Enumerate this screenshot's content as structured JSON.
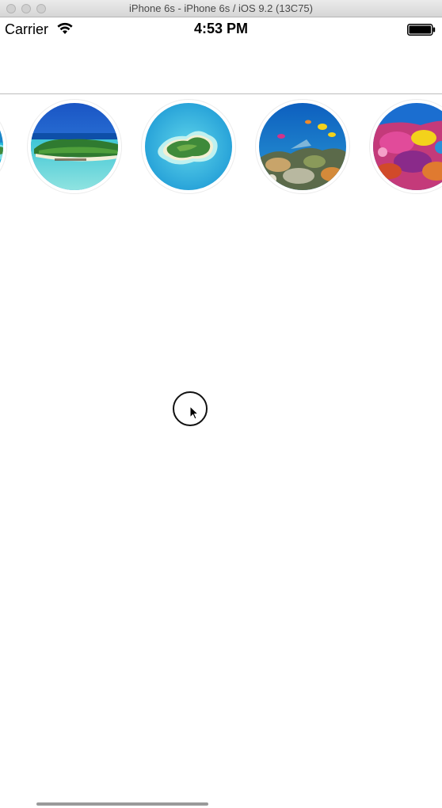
{
  "window": {
    "title": "iPhone 6s - iPhone 6s / iOS 9.2 (13C75)"
  },
  "status_bar": {
    "carrier": "Carrier",
    "time": "4:53 PM",
    "signal_icon": "wifi-icon",
    "battery_icon": "battery-icon"
  },
  "stories": [
    {
      "name": "story-island-left-partial",
      "scene": "lagoon"
    },
    {
      "name": "story-island-beach",
      "scene": "island-beach"
    },
    {
      "name": "story-island-aerial",
      "scene": "island-aerial"
    },
    {
      "name": "story-coral-reef-fish",
      "scene": "reef-fish"
    },
    {
      "name": "story-coral-reef-colorful",
      "scene": "reef-colorful"
    }
  ],
  "colors": {
    "sky": "#1f6fd6",
    "sea": "#22b6d8",
    "lagoon": "#7fe0e6",
    "island": "#3f8a3a",
    "reef_pink": "#d2338a",
    "reef_yellow": "#f3d21b",
    "navbar_border": "#bcbcbc"
  }
}
